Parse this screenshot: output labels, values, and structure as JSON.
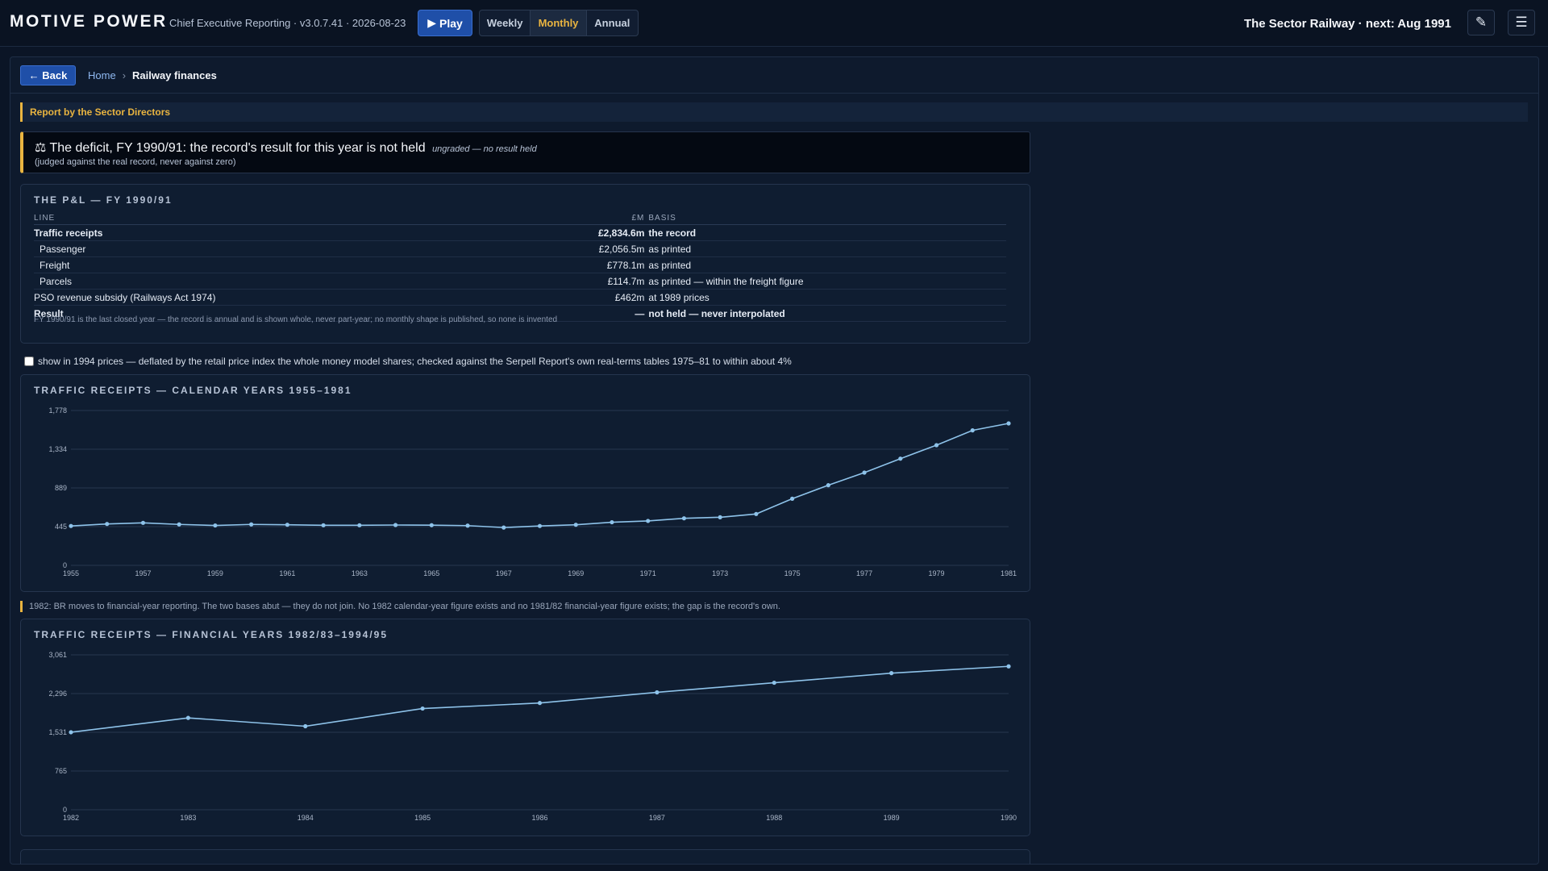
{
  "header": {
    "brand": "MOTIVE POWER",
    "subtitle": "Chief Executive Reporting · v3.0.7.41 · 2026-08-23",
    "play_label": "Play",
    "periods": [
      "Weekly",
      "Monthly",
      "Annual"
    ],
    "active_period": "Monthly",
    "next_label": "The Sector Railway · next: Aug 1991",
    "edit_icon": "pencil-icon",
    "menu_icon": "hamburger-menu-icon"
  },
  "breadcrumb": {
    "back_label": "← Back",
    "home": "Home",
    "separator": "›",
    "current": "Railway finances"
  },
  "report": {
    "section_title": "Report by the Sector Directors",
    "verdict_icon": "⚖",
    "verdict_text": "The deficit, FY 1990/91: the record's result for this year is not held",
    "verdict_grade": "ungraded — no result held",
    "verdict_note": "(judged against the real record, never against zero)"
  },
  "pl": {
    "title": "THE P&L — FY 1990/91",
    "columns": [
      "LINE",
      "£M",
      "BASIS"
    ],
    "rows": [
      {
        "line": "Traffic receipts",
        "value": "£2,834.6m",
        "basis": "the record"
      },
      {
        "line": "Passenger",
        "value": "£2,056.5m",
        "basis": "as printed"
      },
      {
        "line": "Freight",
        "value": "£778.1m",
        "basis": "as printed"
      },
      {
        "line": "Parcels",
        "value": "£114.7m",
        "basis": "as printed — within the freight figure"
      },
      {
        "line": "PSO revenue subsidy (Railways Act 1974)",
        "value": "£462m",
        "basis": "at 1989 prices"
      },
      {
        "line": "Result",
        "value": "—",
        "basis": "not held — never interpolated"
      }
    ],
    "note": "FY 1990/91 is the last closed year — the record is annual and is shown whole, never part-year; no monthly shape is published, so none is invented"
  },
  "toggle": {
    "label": "show in 1994 prices — deflated by the retail price index the whole money model shares; checked against the Serpell Report's own real-terms tables 1975–81 to within about 4%",
    "checked": false
  },
  "gap_note": "1982: BR moves to financial-year reporting. The two bases abut — they do not join. No 1982 calendar-year figure exists and no 1981/82 financial-year figure exists; the gap is the record's own.",
  "colors": {
    "accent": "#e9b440",
    "line": "#8ec3ea",
    "button": "#1f4fa8"
  },
  "chart_data": [
    {
      "type": "line",
      "title": "TRAFFIC RECEIPTS — CALENDAR YEARS 1955–1981",
      "x": [
        1955,
        1956,
        1957,
        1958,
        1959,
        1960,
        1961,
        1962,
        1963,
        1964,
        1965,
        1966,
        1967,
        1968,
        1969,
        1970,
        1971,
        1972,
        1973,
        1974,
        1975,
        1976,
        1977,
        1978,
        1979,
        1980,
        1981
      ],
      "x_ticks": [
        "1955",
        "1957",
        "1959",
        "1961",
        "1963",
        "1965",
        "1967",
        "1969",
        "1971",
        "1973",
        "1975",
        "1977",
        "1979",
        "1981"
      ],
      "series": [
        {
          "values": [
            452,
            475,
            488,
            470,
            458,
            470,
            466,
            460,
            460,
            463,
            461,
            456,
            434,
            452,
            466,
            495,
            510,
            540,
            552,
            590,
            765,
            920,
            1065,
            1225,
            1380,
            1550,
            1630
          ]
        }
      ],
      "ylim": [
        0,
        1778
      ],
      "y_ticks": [
        "0",
        "445",
        "889",
        "1,334",
        "1,778"
      ],
      "grid": true
    },
    {
      "type": "line",
      "title": "TRAFFIC RECEIPTS — FINANCIAL YEARS 1982/83–1994/95",
      "x": [
        1982,
        1983,
        1984,
        1985,
        1986,
        1987,
        1988,
        1989,
        1990
      ],
      "x_ticks": [
        "1982",
        "1983",
        "1984",
        "1985",
        "1986",
        "1987",
        "1988",
        "1989",
        "1990"
      ],
      "series": [
        {
          "values": [
            1531,
            1815,
            1650,
            2000,
            2110,
            2320,
            2510,
            2700,
            2834
          ]
        }
      ],
      "ylim": [
        0,
        3061
      ],
      "y_ticks": [
        "0",
        "765",
        "1,531",
        "2,296",
        "3,061"
      ],
      "grid": true
    }
  ]
}
